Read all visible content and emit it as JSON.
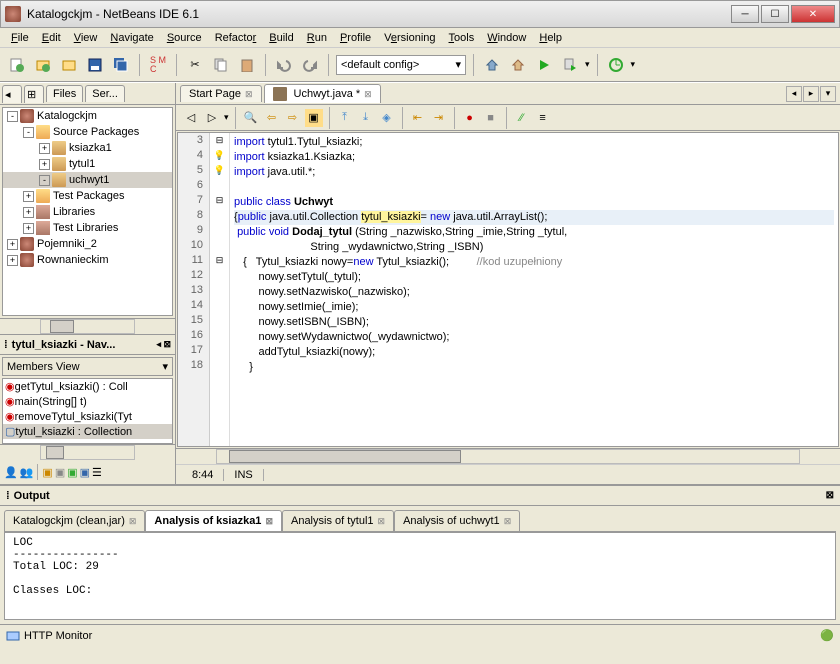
{
  "title": "Katalogckjm - NetBeans IDE 6.1",
  "menu": [
    "File",
    "Edit",
    "View",
    "Navigate",
    "Source",
    "Refactor",
    "Build",
    "Run",
    "Profile",
    "Versioning",
    "Tools",
    "Window",
    "Help"
  ],
  "config": "<default config>",
  "projectsPanel": {
    "tabs": [
      "Files",
      "Ser..."
    ],
    "tree": [
      {
        "indent": 0,
        "toggle": "-",
        "icon": "cup",
        "label": "Katalogckjm"
      },
      {
        "indent": 1,
        "toggle": "-",
        "icon": "folder",
        "label": "Source Packages"
      },
      {
        "indent": 2,
        "toggle": "+",
        "icon": "pkg",
        "label": "ksiazka1"
      },
      {
        "indent": 2,
        "toggle": "+",
        "icon": "pkg",
        "label": "tytul1"
      },
      {
        "indent": 2,
        "toggle": "-",
        "icon": "pkg",
        "label": "uchwyt1",
        "selected": true
      },
      {
        "indent": 1,
        "toggle": "+",
        "icon": "folder",
        "label": "Test Packages"
      },
      {
        "indent": 1,
        "toggle": "+",
        "icon": "lib",
        "label": "Libraries"
      },
      {
        "indent": 1,
        "toggle": "+",
        "icon": "lib",
        "label": "Test Libraries"
      },
      {
        "indent": 0,
        "toggle": "+",
        "icon": "cup",
        "label": "Pojemniki_2"
      },
      {
        "indent": 0,
        "toggle": "+",
        "icon": "cup",
        "label": "Rownanieckim"
      }
    ]
  },
  "navigator": {
    "title": "tytul_ksiazki - Nav...",
    "combo": "Members View",
    "items": [
      {
        "icon": "m",
        "label": "getTytul_ksiazki() : Coll"
      },
      {
        "icon": "m",
        "label": "main(String[] t)"
      },
      {
        "icon": "m",
        "label": "removeTytul_ksiazki(Tyt"
      },
      {
        "icon": "f",
        "label": "tytul_ksiazki : Collection",
        "selected": true
      }
    ]
  },
  "editor": {
    "tabs": [
      {
        "label": "Start Page",
        "active": false
      },
      {
        "label": "Uchwyt.java *",
        "active": true
      }
    ],
    "status": {
      "pos": "8:44",
      "mode": "INS"
    },
    "lines": [
      3,
      4,
      5,
      6,
      7,
      8,
      9,
      10,
      11,
      12,
      13,
      14,
      15,
      16,
      17,
      18
    ],
    "code": {
      "l3": {
        "pre": "",
        "kw": "import",
        "rest": " tytul1.Tytul_ksiazki;"
      },
      "l4": {
        "pre": "",
        "kw": "import",
        "rest": " ksiazka1.Ksiazka;"
      },
      "l5": {
        "pre": "",
        "kw": "import",
        "rest": " java.util.*;"
      },
      "l6": "",
      "l7": {
        "kw1": "public",
        "kw2": "class",
        "name": "Uchwyt"
      },
      "l8": {
        "open": "{",
        "kw1": "public",
        "type": " java.util.Collection ",
        "hl": "tytul_ksiazki",
        "eq": "= ",
        "kw2": "new",
        "rest": " java.util.ArrayList();"
      },
      "l9": {
        "pre": " ",
        "kw1": "public",
        "kw2": "void",
        "name": "Dodaj_tytul",
        "args": " (String _nazwisko,String _imie,String _tytul,"
      },
      "l10": "                         String _wydawnictwo,String _ISBN)",
      "l11": {
        "pre": "   {   Tytul_ksiazki nowy=",
        "kw": "new",
        "mid": " Tytul_ksiazki();",
        "pad": "         ",
        "comment": "//kod uzupełniony"
      },
      "l12": "        nowy.setTytul(_tytul);",
      "l13": "        nowy.setNazwisko(_nazwisko);",
      "l14": "        nowy.setImie(_imie);",
      "l15": "        nowy.setISBN(_ISBN);",
      "l16": "        nowy.setWydawnictwo(_wydawnictwo);",
      "l17": "        addTytul_ksiazki(nowy);",
      "l18": "     }"
    }
  },
  "output": {
    "title": "Output",
    "tabs": [
      {
        "label": "Katalogckjm (clean,jar)",
        "active": false
      },
      {
        "label": "Analysis of ksiazka1",
        "active": true
      },
      {
        "label": "Analysis of tytul1",
        "active": false
      },
      {
        "label": "Analysis of uchwyt1",
        "active": false
      }
    ],
    "content": "LOC\n----------------\nTotal LOC: 29\n\nClasses LOC:"
  },
  "footer": {
    "label": "HTTP Monitor"
  }
}
